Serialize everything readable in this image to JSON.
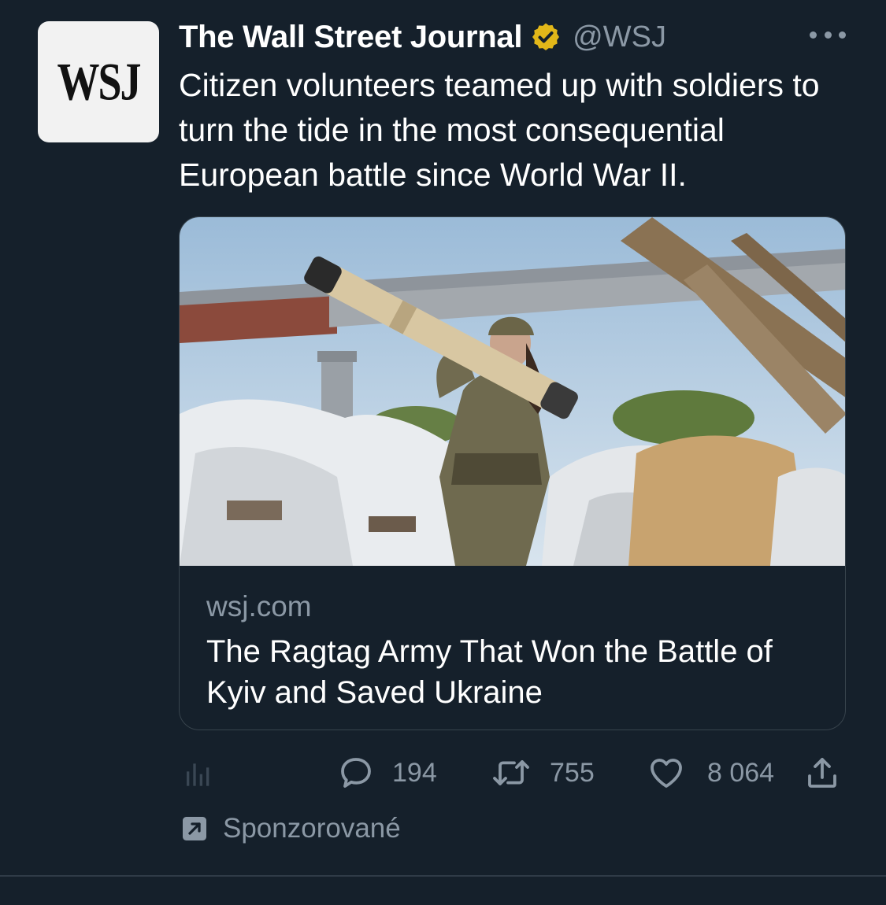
{
  "author": {
    "avatar_text": "WSJ",
    "name": "The Wall Street Journal",
    "handle": "@WSJ",
    "verified": true
  },
  "tweet": {
    "text": "Citizen volunteers teamed up with soldiers to turn the tide in the most consequential European battle since World War II."
  },
  "card": {
    "domain": "wsj.com",
    "title": "The Ragtag Army That Won the Battle of Kyiv and Saved Ukraine"
  },
  "actions": {
    "replies": "194",
    "retweets": "755",
    "likes": "8 064"
  },
  "sponsored": {
    "label": "Sponzorované"
  },
  "icons": [
    "analytics-icon",
    "reply-icon",
    "retweet-icon",
    "like-icon",
    "share-icon",
    "more-icon",
    "verified-badge-icon",
    "promoted-icon"
  ],
  "colors": {
    "background": "#15202b",
    "primary_text": "#ffffff",
    "secondary_text": "#8b98a5",
    "verified_gold": "#e2b719",
    "border": "#38444d"
  }
}
